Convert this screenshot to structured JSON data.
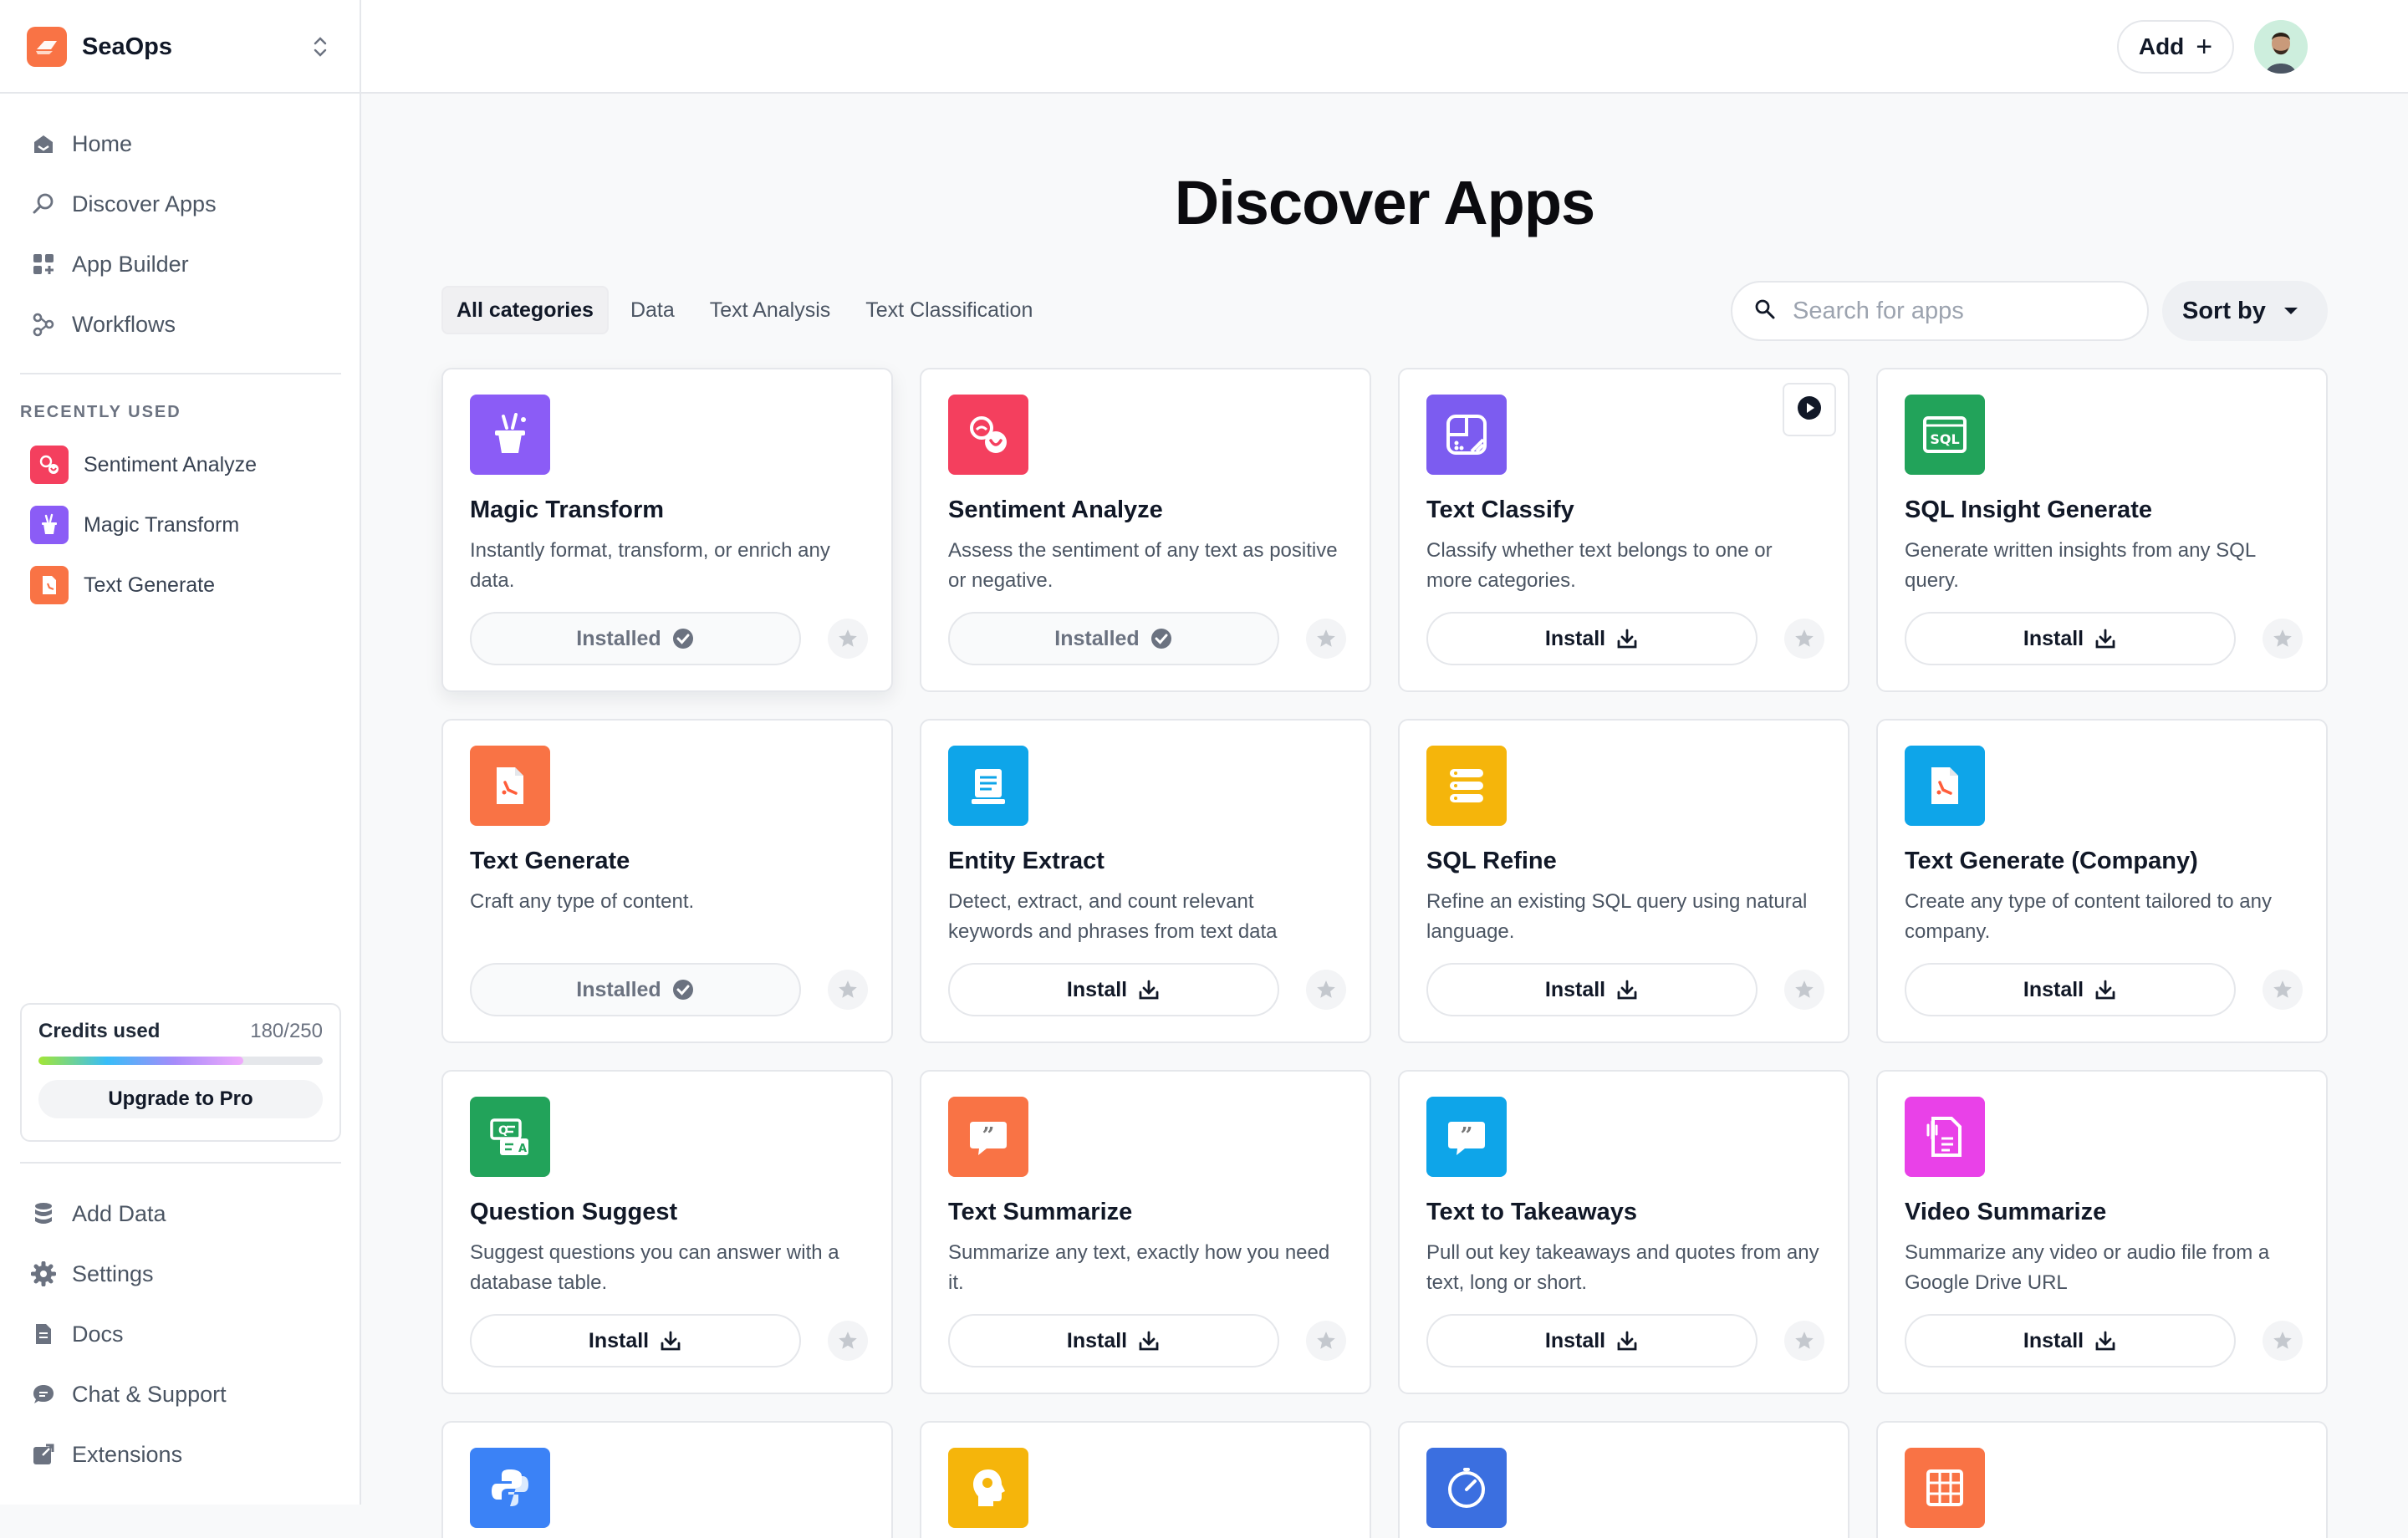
{
  "brand": {
    "name": "SeaOps",
    "accent": "#f97345"
  },
  "header": {
    "add_label": "Add"
  },
  "nav_main": [
    {
      "label": "Home",
      "icon": "home-icon"
    },
    {
      "label": "Discover Apps",
      "icon": "search-icon"
    },
    {
      "label": "App Builder",
      "icon": "grid-plus-icon"
    },
    {
      "label": "Workflows",
      "icon": "workflow-icon"
    }
  ],
  "recent": {
    "title": "RECENTLY USED",
    "items": [
      {
        "label": "Sentiment Analyze",
        "color": "#f43f5e"
      },
      {
        "label": "Magic Transform",
        "color": "#8b5cf6"
      },
      {
        "label": "Text Generate",
        "color": "#f97345"
      }
    ]
  },
  "credits": {
    "label": "Credits used",
    "value": "180/250",
    "fraction": 0.72,
    "upgrade_label": "Upgrade to Pro"
  },
  "nav_bottom": [
    {
      "label": "Add Data",
      "icon": "database-icon"
    },
    {
      "label": "Settings",
      "icon": "gear-icon"
    },
    {
      "label": "Docs",
      "icon": "document-icon"
    },
    {
      "label": "Chat & Support",
      "icon": "chat-icon"
    },
    {
      "label": "Extensions",
      "icon": "external-link-icon"
    }
  ],
  "main": {
    "title": "Discover Apps",
    "filters": [
      "All categories",
      "Data",
      "Text Analysis",
      "Text Classification"
    ],
    "search_placeholder": "Search for apps",
    "sort_label": "Sort by"
  },
  "labels": {
    "installed": "Installed",
    "install": "Install"
  },
  "apps": [
    {
      "title": "Magic Transform",
      "desc": "Instantly format, transform, or enrich any data.",
      "color": "#8b5cf6",
      "icon": "magic-hat-icon",
      "installed": true
    },
    {
      "title": "Sentiment Analyze",
      "desc": "Assess the sentiment of any text as positive or negative.",
      "color": "#f43f5e",
      "icon": "sentiment-icon",
      "installed": true
    },
    {
      "title": "Text Classify",
      "desc": "Classify whether text belongs to one or more categories.",
      "color": "#7c5cf0",
      "icon": "classify-icon",
      "installed": false
    },
    {
      "title": "SQL Insight Generate",
      "desc": "Generate written insights from any SQL query.",
      "color": "#22a35a",
      "icon": "sql-window-icon",
      "installed": false
    },
    {
      "title": "Text Generate",
      "desc": "Craft any type of content.",
      "color": "#f97345",
      "icon": "document-sparkle-icon",
      "installed": true
    },
    {
      "title": "Entity Extract",
      "desc": "Detect, extract, and count relevant keywords and phrases from text data",
      "color": "#0ea5e9",
      "icon": "extract-icon",
      "installed": false
    },
    {
      "title": "SQL Refine",
      "desc": "Refine an existing SQL query using natural language.",
      "color": "#f5b50b",
      "icon": "server-stack-icon",
      "installed": false
    },
    {
      "title": "Text Generate (Company)",
      "desc": "Create any type of content tailored to any company.",
      "color": "#0ea5e9",
      "icon": "document-sparkle-icon",
      "installed": false
    },
    {
      "title": "Question Suggest",
      "desc": "Suggest questions you can answer with a database table.",
      "color": "#22a35a",
      "icon": "question-cards-icon",
      "installed": false
    },
    {
      "title": "Text Summarize",
      "desc": "Summarize any text, exactly how you need it.",
      "color": "#f97345",
      "icon": "quote-bubble-icon",
      "installed": false
    },
    {
      "title": "Text to Takeaways",
      "desc": "Pull out key takeaways and quotes from any text, long or short.",
      "color": "#0ea5e9",
      "icon": "quote-bubble-icon",
      "installed": false
    },
    {
      "title": "Video Summarize",
      "desc": "Summarize any video or audio file from a Google Drive URL",
      "color": "#e941e8",
      "icon": "audio-doc-icon",
      "installed": false
    }
  ],
  "apps_partial": [
    {
      "color": "#3b82f6",
      "icon": "python-icon"
    },
    {
      "color": "#f5b50b",
      "icon": "head-bulb-icon"
    },
    {
      "color": "#3b6fe0",
      "icon": "gauge-icon"
    },
    {
      "color": "#f97345",
      "icon": "table-grid-icon"
    }
  ]
}
